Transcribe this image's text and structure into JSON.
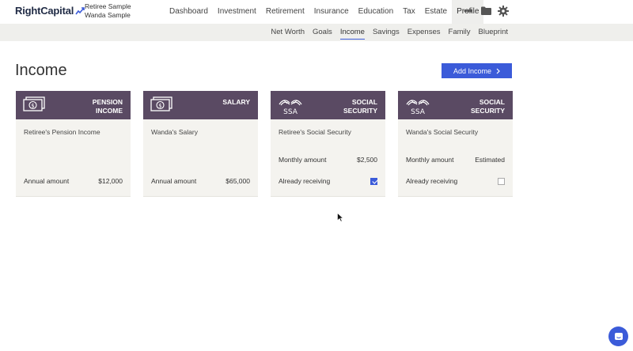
{
  "brand": {
    "logo_text": "RightCapital",
    "accent": "#3b5bd9",
    "header_color": "#5a4a63"
  },
  "clients": [
    "Retiree Sample",
    "Wanda Sample"
  ],
  "main_nav": [
    {
      "label": "Dashboard",
      "active": false
    },
    {
      "label": "Investment",
      "active": false
    },
    {
      "label": "Retirement",
      "active": false
    },
    {
      "label": "Insurance",
      "active": false
    },
    {
      "label": "Education",
      "active": false
    },
    {
      "label": "Tax",
      "active": false
    },
    {
      "label": "Estate",
      "active": false
    },
    {
      "label": "Profile",
      "active": true
    }
  ],
  "top_icons": [
    "more-icon",
    "folder-icon",
    "gear-icon"
  ],
  "sub_nav": [
    {
      "label": "Net Worth",
      "active": false
    },
    {
      "label": "Goals",
      "active": false
    },
    {
      "label": "Income",
      "active": true
    },
    {
      "label": "Savings",
      "active": false
    },
    {
      "label": "Expenses",
      "active": false
    },
    {
      "label": "Family",
      "active": false
    },
    {
      "label": "Blueprint",
      "active": false
    }
  ],
  "page": {
    "title": "Income",
    "add_button_label": "Add Income"
  },
  "cards": [
    {
      "icon": "cash-icon",
      "title": "PENSION INCOME",
      "name": "Retiree's Pension Income",
      "rows": [
        {
          "label": "Annual amount",
          "value": "$12,000"
        }
      ]
    },
    {
      "icon": "cash-icon",
      "title": "SALARY",
      "name": "Wanda's Salary",
      "rows": [
        {
          "label": "Annual amount",
          "value": "$65,000"
        }
      ]
    },
    {
      "icon": "ssa-icon",
      "icon_text": "SSA",
      "title": "SOCIAL SECURITY",
      "name": "Retiree's Social Security",
      "rows": [
        {
          "label": "Monthly amount",
          "value": "$2,500"
        },
        {
          "label": "Already receiving",
          "checked": true
        }
      ]
    },
    {
      "icon": "ssa-icon",
      "icon_text": "SSA",
      "title": "SOCIAL SECURITY",
      "name": "Wanda's Social Security",
      "rows": [
        {
          "label": "Monthly amount",
          "value": "Estimated"
        },
        {
          "label": "Already receiving",
          "checked": false
        }
      ]
    }
  ]
}
